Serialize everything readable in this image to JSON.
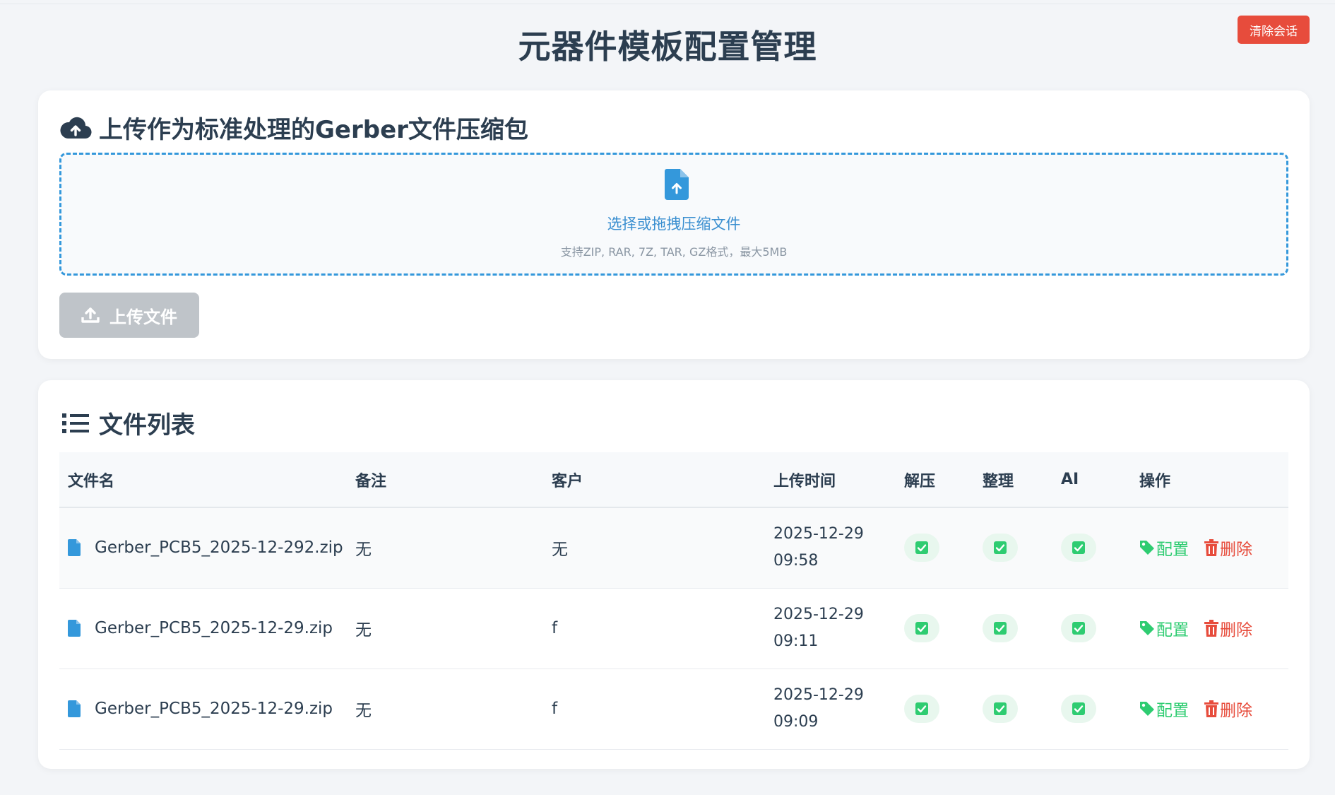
{
  "header": {
    "title": "元器件模板配置管理",
    "clear_session_label": "清除会话"
  },
  "upload": {
    "section_title": "上传作为标准处理的Gerber文件压缩包",
    "dropzone_text": "选择或拖拽压缩文件",
    "dropzone_hint": "支持ZIP, RAR, 7Z, TAR, GZ格式，最大5MB",
    "upload_button_label": "上传文件"
  },
  "file_list": {
    "section_title": "文件列表",
    "columns": [
      "文件名",
      "备注",
      "客户",
      "上传时间",
      "解压",
      "整理",
      "AI",
      "操作"
    ],
    "rows": [
      {
        "filename": "Gerber_PCB5_2025-12-292.zip",
        "note": "无",
        "customer": "无",
        "date": "2025-12-29",
        "time": "09:58",
        "unzip": true,
        "organize": true,
        "ai": true
      },
      {
        "filename": "Gerber_PCB5_2025-12-29.zip",
        "note": "无",
        "customer": "f",
        "date": "2025-12-29",
        "time": "09:11",
        "unzip": true,
        "organize": true,
        "ai": true
      },
      {
        "filename": "Gerber_PCB5_2025-12-29.zip",
        "note": "无",
        "customer": "f",
        "date": "2025-12-29",
        "time": "09:09",
        "unzip": true,
        "organize": true,
        "ai": true
      }
    ],
    "config_label": "配置",
    "delete_label": "删除"
  },
  "colors": {
    "accent": "#3498db",
    "danger": "#e74c3c",
    "success": "#2ecc71",
    "text": "#2c3e50"
  }
}
